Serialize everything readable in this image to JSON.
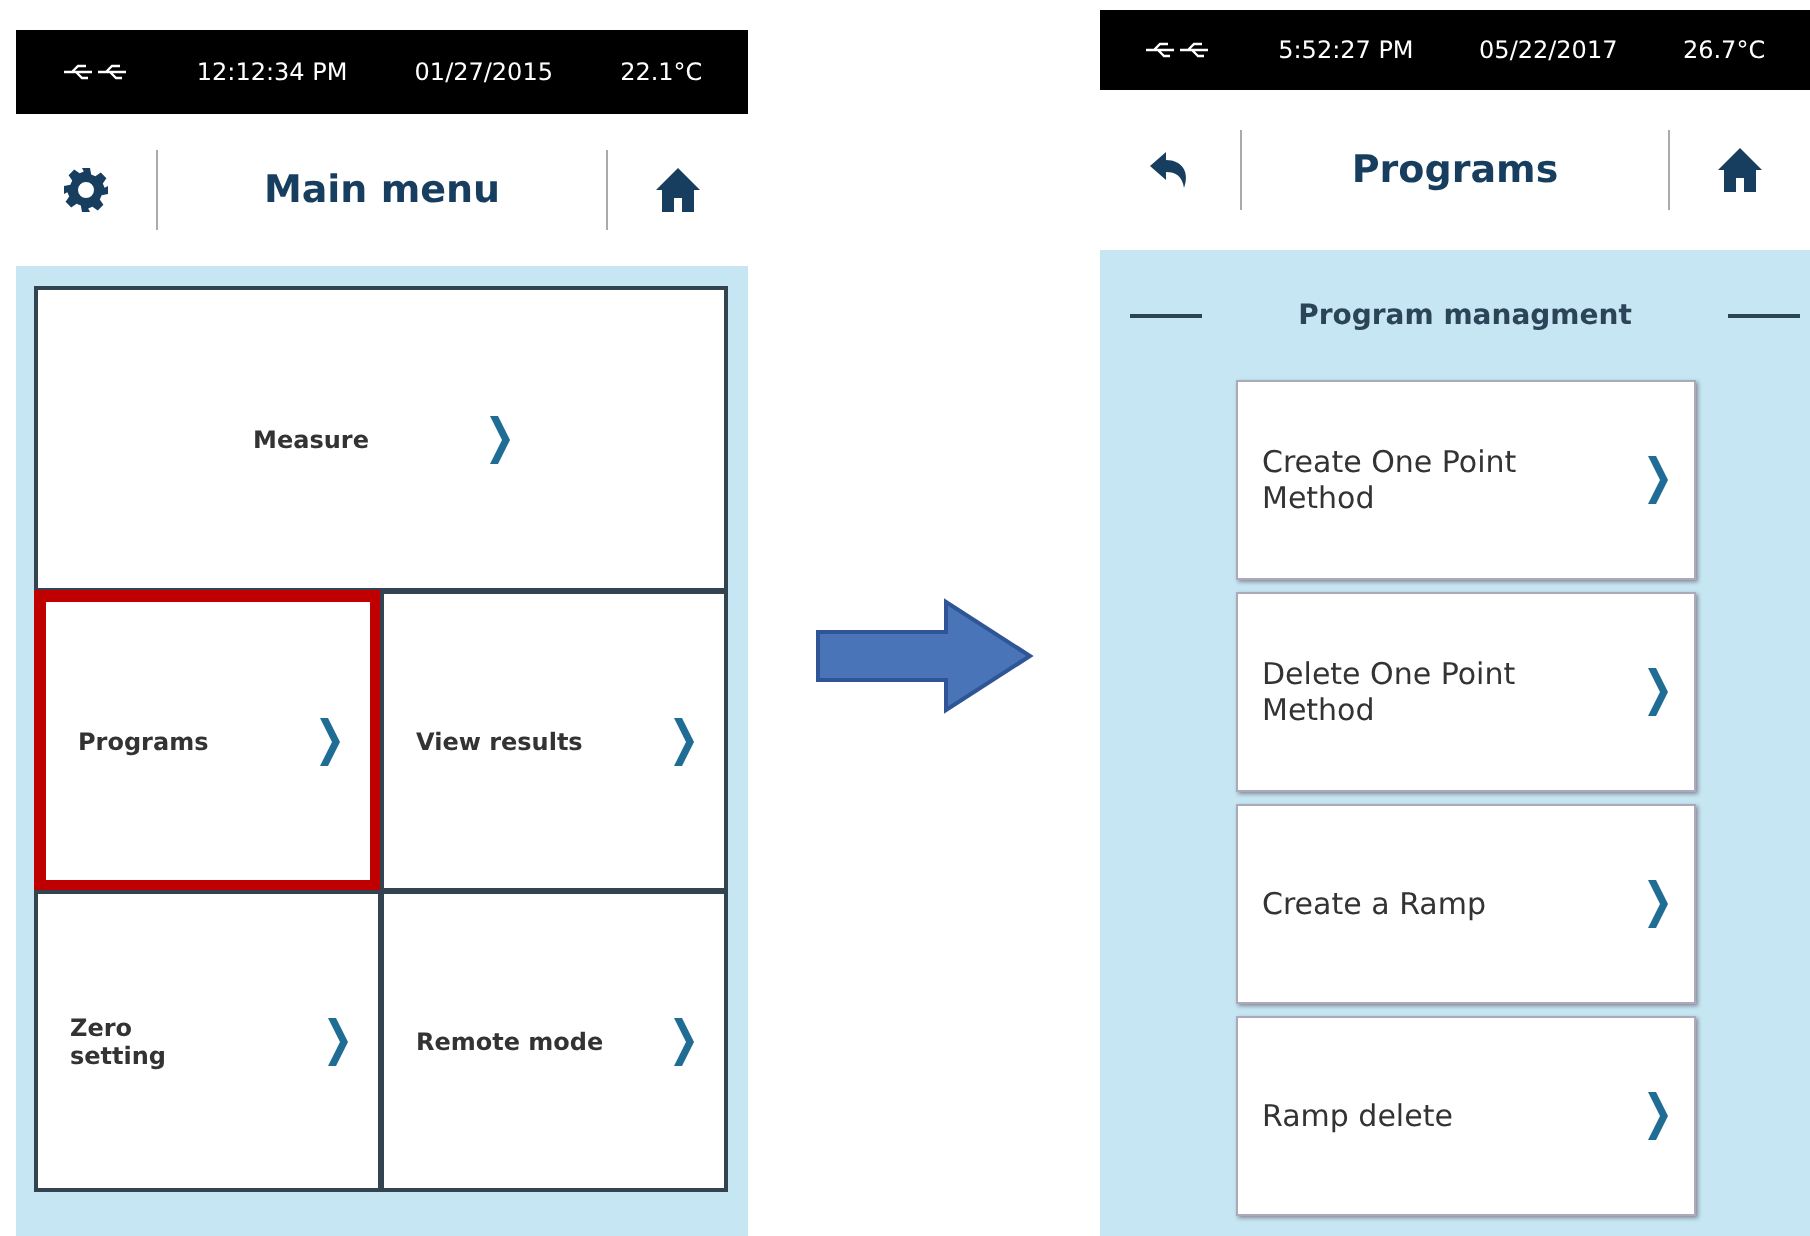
{
  "screens": [
    {
      "status_bar": {
        "time": "12:12:34 PM",
        "date": "01/27/2015",
        "temperature": "22.1°C"
      },
      "header": {
        "left_button": {
          "kind": "settings"
        },
        "title": "Main menu"
      },
      "kind": "grid",
      "tiles": [
        {
          "label": "Measure",
          "wide": true,
          "highlighted": false
        },
        {
          "label": "Programs",
          "wide": false,
          "highlighted": true
        },
        {
          "label": "View results",
          "wide": false,
          "highlighted": false
        },
        {
          "label": "Zero\nsetting",
          "wide": false,
          "highlighted": false
        },
        {
          "label": "Remote mode",
          "wide": false,
          "highlighted": false
        }
      ]
    },
    {
      "status_bar": {
        "time": "5:52:27 PM",
        "date": "05/22/2017",
        "temperature": "26.7°C"
      },
      "header": {
        "left_button": {
          "kind": "back"
        },
        "title": "Programs"
      },
      "kind": "list",
      "section_title": "Program managment",
      "tiles": [
        {
          "label": "Create One Point\nMethod",
          "highlighted": false
        },
        {
          "label": "Delete  One Point\nMethod",
          "highlighted": false
        },
        {
          "label": "Create a Ramp",
          "highlighted": false
        },
        {
          "label": "Ramp delete",
          "highlighted": false
        }
      ]
    }
  ]
}
